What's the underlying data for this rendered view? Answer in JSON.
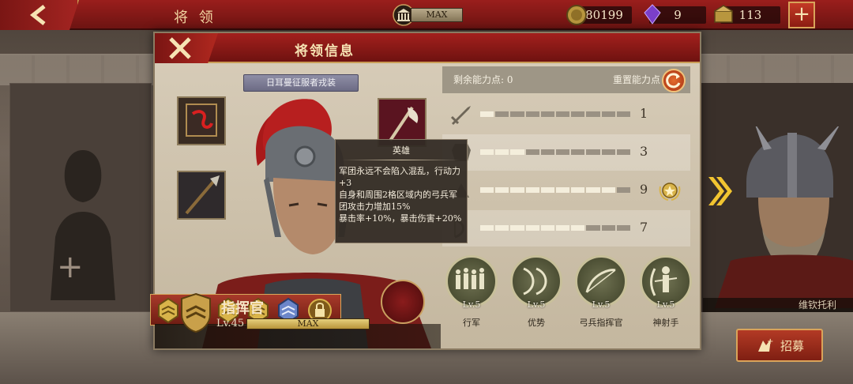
{
  "topbar": {
    "title": "将 领",
    "center_label": "MAX",
    "coins": "80199",
    "gems": "9",
    "supply": "113",
    "plus": "+"
  },
  "dialog": {
    "title": "将领信息",
    "outfit_label": "日耳曼征服者戎装",
    "hero_title": "指挥官",
    "level": "Lv.45",
    "level_bar": "MAX",
    "stats": {
      "remaining_label": "剩余能力点:",
      "remaining_value": "0",
      "reset_label": "重置能力点",
      "rows": [
        {
          "value": "1",
          "filled": 1,
          "icon": "sword-icon"
        },
        {
          "value": "3",
          "filled": 3,
          "icon": "armor-icon"
        },
        {
          "value": "9",
          "filled": 9,
          "icon": "speed-icon",
          "starred": true
        },
        {
          "value": "7",
          "filled": 7,
          "icon": "bow-icon"
        }
      ],
      "segments_total": 10
    },
    "skills": [
      {
        "lv": "Lv.5",
        "name": "行军"
      },
      {
        "lv": "Lv.5",
        "name": "优势"
      },
      {
        "lv": "Lv.5",
        "name": "弓兵指挥官"
      },
      {
        "lv": "Lv.5",
        "name": "神射手"
      }
    ],
    "tooltip": {
      "title": "英雄",
      "body": "军团永远不会陷入混乱，行动力\n+3\n自身和周围2格区域内的弓兵军\n团攻击力增加15%\n暴击率+10%，暴击伤害+20%"
    }
  },
  "side": {
    "right_name": "维钦托利",
    "recruit": "招募"
  },
  "colors": {
    "topbar": "#8a1b19",
    "accent_gold": "#d9a45a",
    "panel": "#c9bda8"
  }
}
